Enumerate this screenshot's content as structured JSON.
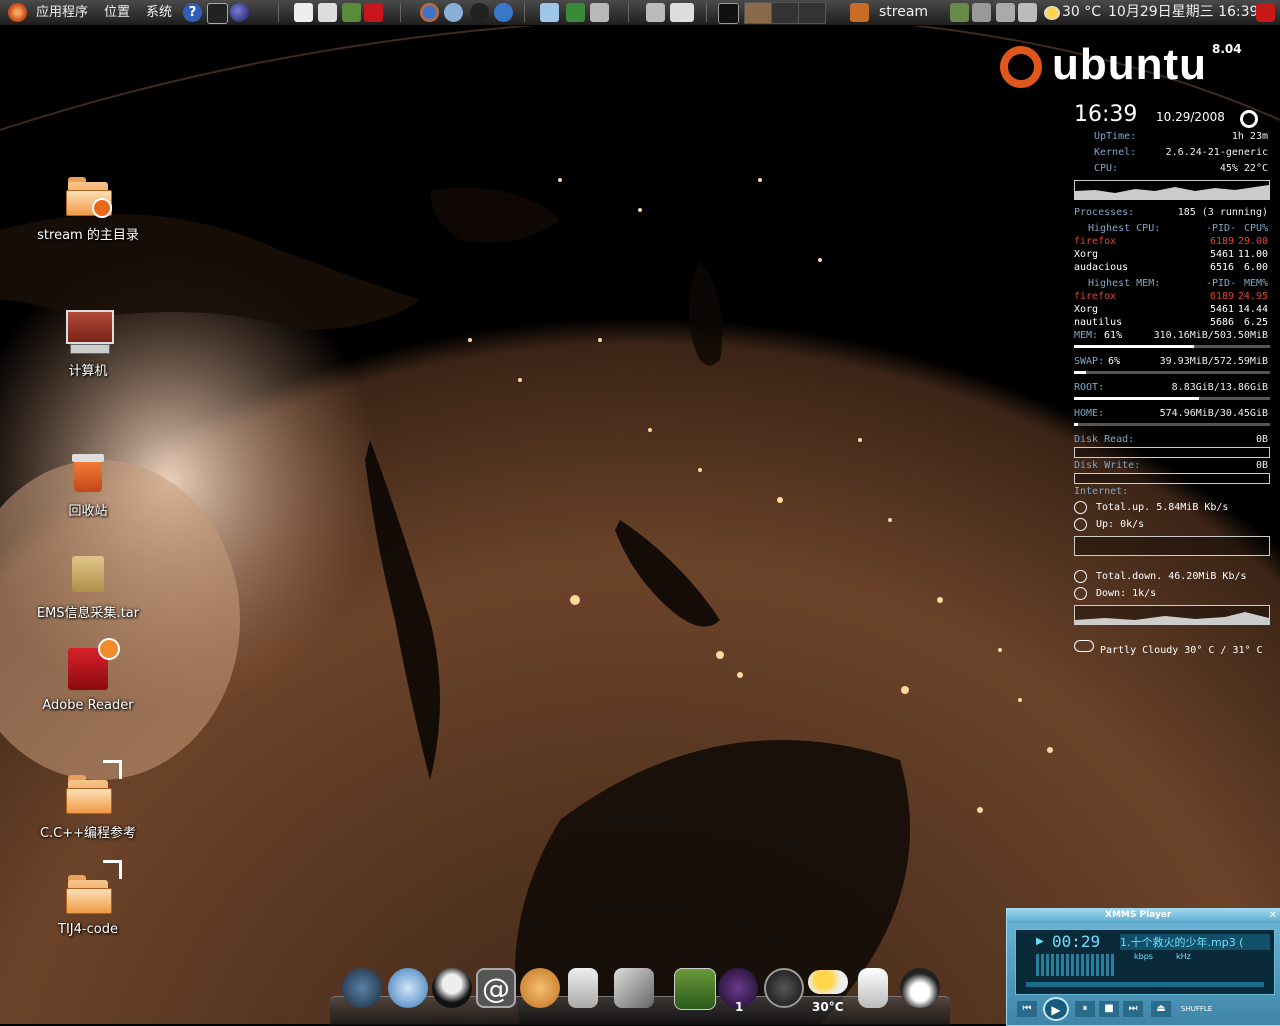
{
  "top_panel": {
    "menus": [
      "应用程序",
      "位置",
      "系统"
    ],
    "stream_label": "stream",
    "weather_temp": "30 °C",
    "datetime": "10月29日星期三 16:39"
  },
  "desktop_icons": [
    {
      "label": "stream 的主目录",
      "icon": "home-folder-icon"
    },
    {
      "label": "计算机",
      "icon": "computer-icon"
    },
    {
      "label": "回收站",
      "icon": "trash-icon"
    },
    {
      "label": "EMS信息采集.tar",
      "icon": "archive-icon"
    },
    {
      "label": "Adobe Reader",
      "icon": "adobe-reader-icon"
    },
    {
      "label": "C.C++编程参考",
      "icon": "folder-link-icon"
    },
    {
      "label": "TIJ4-code",
      "icon": "folder-link-icon"
    }
  ],
  "ubuntu_logo": {
    "word": "ubuntu",
    "version": "8.04",
    "color": "#e0571e"
  },
  "conky": {
    "time": "16:39",
    "date": "10.29/2008",
    "uptime_label": "UpTime:",
    "uptime": "1h 23m",
    "kernel_label": "Kernel:",
    "kernel": "2.6.24-21-generic",
    "cpu_label": "CPU:",
    "cpu": "45% 22°C",
    "processes_label": "Processes:",
    "processes": "185  (3 running)",
    "top_cpu": {
      "title": "Highest CPU:",
      "pid_header": "-PID-",
      "val_header": "CPU%",
      "rows": [
        {
          "name": "firefox",
          "pid": "6189",
          "val": "29.00"
        },
        {
          "name": "Xorg",
          "pid": "5461",
          "val": "11.00"
        },
        {
          "name": "audacious",
          "pid": "6516",
          "val": "6.00"
        }
      ]
    },
    "top_mem": {
      "title": "Highest MEM:",
      "pid_header": "-PID-",
      "val_header": "MEM%",
      "rows": [
        {
          "name": "firefox",
          "pid": "6189",
          "val": "24.95"
        },
        {
          "name": "Xorg",
          "pid": "5461",
          "val": "14.44"
        },
        {
          "name": "nautilus",
          "pid": "5686",
          "val": "6.25"
        }
      ]
    },
    "mem_label": "MEM:",
    "mem_pct": "61%",
    "mem": "310.16MiB/503.50MiB",
    "mem_fill": 0.61,
    "swap_label": "SWAP:",
    "swap_pct": "6%",
    "swap": "39.93MiB/572.59MiB",
    "swap_fill": 0.06,
    "root_label": "ROOT:",
    "root": "8.83GiB/13.86GiB",
    "root_fill": 0.64,
    "home_label": "HOME:",
    "home": "574.96MiB/30.45GiB",
    "home_fill": 0.02,
    "disk_read_label": "Disk Read:",
    "disk_read": "0B",
    "disk_write_label": "Disk Write:",
    "disk_write": "0B",
    "internet_label": "Internet:",
    "total_up": "Total.up. 5.84MiB Kb/s",
    "up": "Up: 0k/s",
    "total_down": "Total.down. 46.20MiB Kb/s",
    "down": "Down: 1k/s",
    "weather": "Partly Cloudy 30° C / 31° C"
  },
  "dock": {
    "badge_count": "1",
    "weather_temp": "30°C"
  },
  "xmms": {
    "title": "XMMS Player",
    "time": "00:29",
    "track": "1.十个救火的少年.mp3 (",
    "kbps": "kbps",
    "khz": "kHz",
    "shuffle": "SHUFFLE"
  }
}
